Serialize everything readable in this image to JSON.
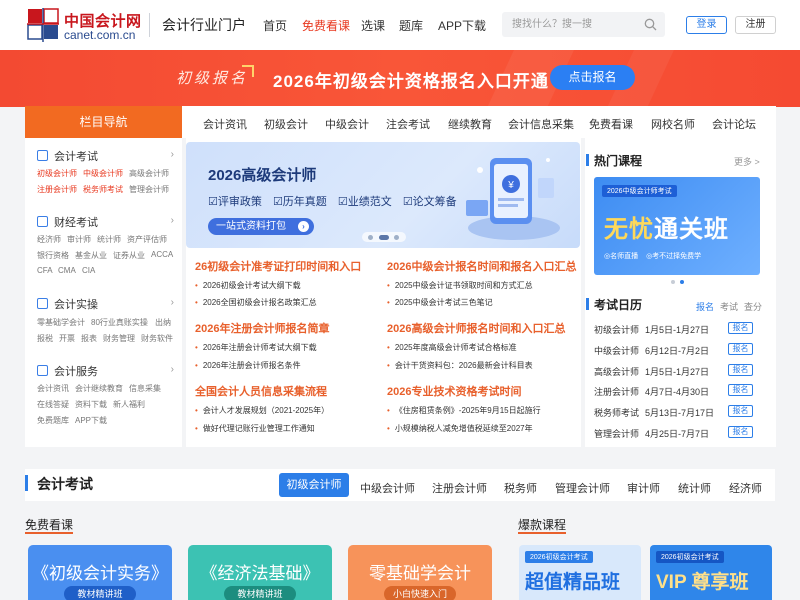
{
  "header": {
    "logo_cn": "中国会计网",
    "logo_en": "canet.com.cn",
    "portal": "会计行业门户",
    "nav": [
      "首页",
      "免费看课",
      "选课",
      "题库",
      "APP下载"
    ],
    "nav_active_index": 1,
    "search_placeholder": "搜找什么？搜一搜",
    "login": "登录",
    "register": "注册"
  },
  "banner": {
    "tag": "初级报名",
    "title": "2026年初级会计资格报名入口开通",
    "button": "点击报名"
  },
  "colors": {
    "brand_red": "#c8161d",
    "banner": "#f34a32",
    "accent_orange": "#f26a21",
    "link_blue": "#2c7ee8",
    "news_orange": "#e8602c"
  },
  "nav_head": "栏目导航",
  "category_nav": [
    "会计资讯",
    "初级会计",
    "中级会计",
    "注会考试",
    "继续教育",
    "会计信息采集",
    "免费看课",
    "网校名师",
    "会计论坛"
  ],
  "sidebar": [
    {
      "title": "会计考试",
      "icon": "book-icon",
      "links": [
        [
          "初级会计师",
          "中级会计师",
          "高级会计师"
        ],
        [
          "注册会计师",
          "税务师考试",
          "管理会计师"
        ]
      ],
      "hot": [
        [
          0,
          0
        ],
        [
          0,
          1
        ],
        [
          1,
          0
        ],
        [
          1,
          1
        ]
      ]
    },
    {
      "title": "财经考试",
      "icon": "tag-icon",
      "links": [
        [
          "经济师",
          "审计师",
          "统计师",
          "资产评估师"
        ],
        [
          "银行资格",
          "基金从业",
          "证券从业",
          "ACCA"
        ],
        [
          "CFA",
          "CMA",
          "CIA"
        ]
      ],
      "hot": []
    },
    {
      "title": "会计实操",
      "icon": "shop-icon",
      "links": [
        [
          "零基础学会计",
          "80行业真账实操",
          "出纳"
        ],
        [
          "报税",
          "开票",
          "报表",
          "财务管理",
          "财务软件"
        ]
      ],
      "hot": []
    },
    {
      "title": "会计服务",
      "icon": "service-icon",
      "links": [
        [
          "会计资讯",
          "会计继续教育",
          "信息采集"
        ],
        [
          "在线答疑",
          "资料下载",
          "新人福利"
        ],
        [
          "免费题库",
          "APP下载"
        ]
      ],
      "hot": []
    }
  ],
  "slide": {
    "title": "2026高级会计师",
    "features": [
      "☑评审政策",
      "☑历年真题",
      "☑业绩范文",
      "☑论文筹备"
    ],
    "button": "一站式资料打包"
  },
  "news": [
    {
      "head": "26初级会计准考证打印时间和入口",
      "items": [
        "2026初级会计考试大纲下载",
        "2026全国初级会计报名政策汇总"
      ]
    },
    {
      "head": "2026中级会计报名时间和报名入口汇总",
      "items": [
        "2025中级会计证书领取时间和方式汇总",
        "2025中级会计考试三色笔记"
      ]
    },
    {
      "head": "2026年注册会计师报名简章",
      "items": [
        "2026年注册会计师考试大纲下载",
        "2026年注册会计师报名条件"
      ]
    },
    {
      "head": "2026高级会计师报名时间和入口汇总",
      "items": [
        "2025年度高级会计师考试合格标准",
        "会计干货资料包：2026最新会计科目表"
      ]
    },
    {
      "head": "全国会计人员信息采集流程",
      "items": [
        "会计人才发展规划（2021-2025年）",
        "做好代理记账行业管理工作通知"
      ]
    },
    {
      "head": "2026专业技术资格考试时间",
      "items": [
        "《住房租赁条例》-2025年9月15日起施行",
        "小规模纳税人减免增值税延续至2027年"
      ]
    }
  ],
  "hot_courses": {
    "title": "热门课程",
    "more": "更多 >",
    "promo_tag": "2026中级会计师考试",
    "promo_name_a": "无忧",
    "promo_name_b": "通关班",
    "promo_features": [
      "◎名师直播",
      "◎考不过择免费学"
    ]
  },
  "calendar": {
    "title": "考试日历",
    "tabs": [
      "报名",
      "考试",
      "查分"
    ],
    "rows": [
      {
        "name": "初级会计师",
        "date": "1月5日-1月27日",
        "btn": "报名"
      },
      {
        "name": "中级会计师",
        "date": "6月12日-7月2日",
        "btn": "报名"
      },
      {
        "name": "高级会计师",
        "date": "1月5日-1月27日",
        "btn": "报名"
      },
      {
        "name": "注册会计师",
        "date": "4月7日-4月30日",
        "btn": "报名"
      },
      {
        "name": "税务师考试",
        "date": "5月13日-7月17日",
        "btn": "报名"
      },
      {
        "name": "管理会计师",
        "date": "4月25日-7月7日",
        "btn": "报名"
      }
    ]
  },
  "exam_section": {
    "title": "会计考试",
    "tabs": [
      "初级会计师",
      "中级会计师",
      "注册会计师",
      "税务师",
      "管理会计师",
      "审计师",
      "统计师",
      "经济师"
    ],
    "active_index": 0,
    "free_title": "免费看课",
    "hot_title": "爆款课程"
  },
  "free_courses": [
    {
      "name": "《初级会计实务》",
      "tag": "教材精讲班",
      "bg": "#4a8ff0",
      "tag_bg": "#1f5fc8"
    },
    {
      "name": "《经济法基础》",
      "tag": "教材精讲班",
      "bg": "#3cc2b3",
      "tag_bg": "#1c8d7f"
    },
    {
      "name": "零基础学会计",
      "tag": "小白快速入门",
      "bg": "#f7935a",
      "tag_bg": "#d9662a"
    }
  ],
  "hot_course_cards": [
    {
      "tag": "2026初级会计考试",
      "name": "超值精品班",
      "bg": "#d8e8fb",
      "color": "#1f6fe0"
    },
    {
      "tag": "2026初级会计考试",
      "name": "VIP 尊享班",
      "bg": "#2f86ea",
      "color": "#ffe08a"
    }
  ]
}
